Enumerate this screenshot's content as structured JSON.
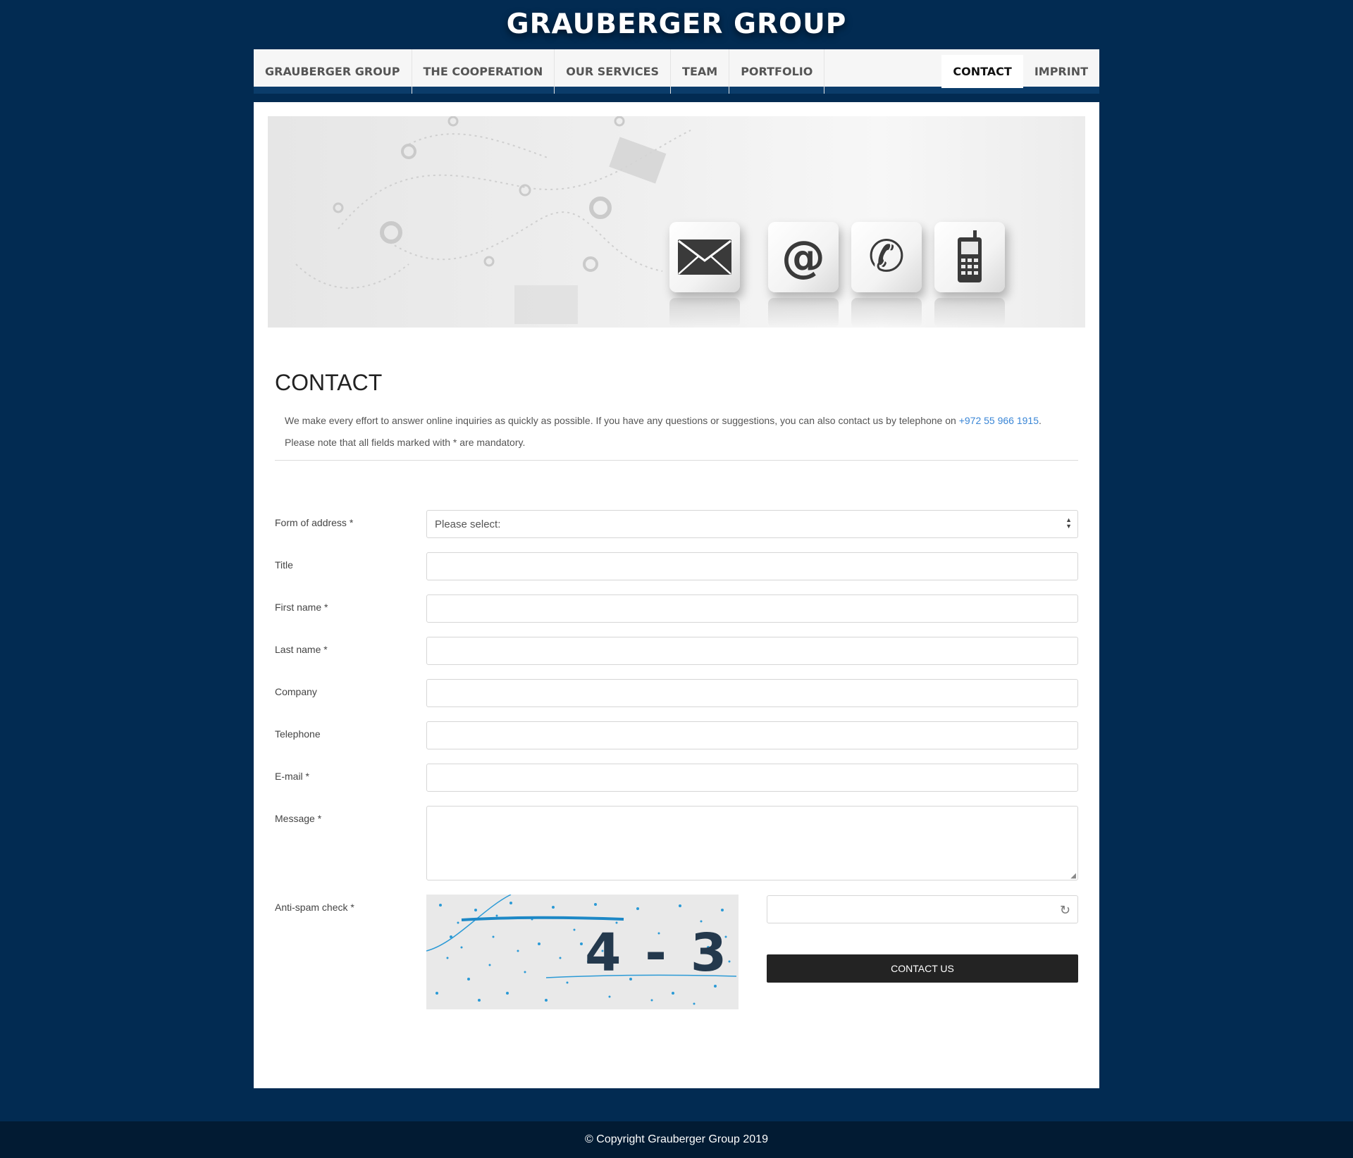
{
  "brand": {
    "logo_text": "GRAUBERGER GROUP"
  },
  "nav": {
    "items": [
      "GRAUBERGER GROUP",
      "THE COOPERATION",
      "OUR SERVICES",
      "TEAM",
      "PORTFOLIO"
    ],
    "contact": "CONTACT",
    "imprint": "IMPRINT"
  },
  "page": {
    "title": "CONTACT",
    "intro_text": "We make every effort to answer online inquiries as quickly as possible. If you have any questions or suggestions, you can also contact us by telephone on ",
    "phone": "+972 55 966 1915",
    "intro_end": ".",
    "note": "Please note that all fields marked with * are mandatory."
  },
  "form": {
    "address_label": "Form of address *",
    "address_placeholder": "Please select:",
    "title_label": "Title",
    "first_name_label": "First name *",
    "last_name_label": "Last name *",
    "company_label": "Company",
    "telephone_label": "Telephone",
    "email_label": "E-mail *",
    "message_label": "Message *",
    "antispam_label": "Anti-spam check *",
    "captcha_text": "4 - 3",
    "submit_label": "CONTACT US"
  },
  "footer": {
    "copyright": "© Copyright Grauberger Group 2019"
  }
}
